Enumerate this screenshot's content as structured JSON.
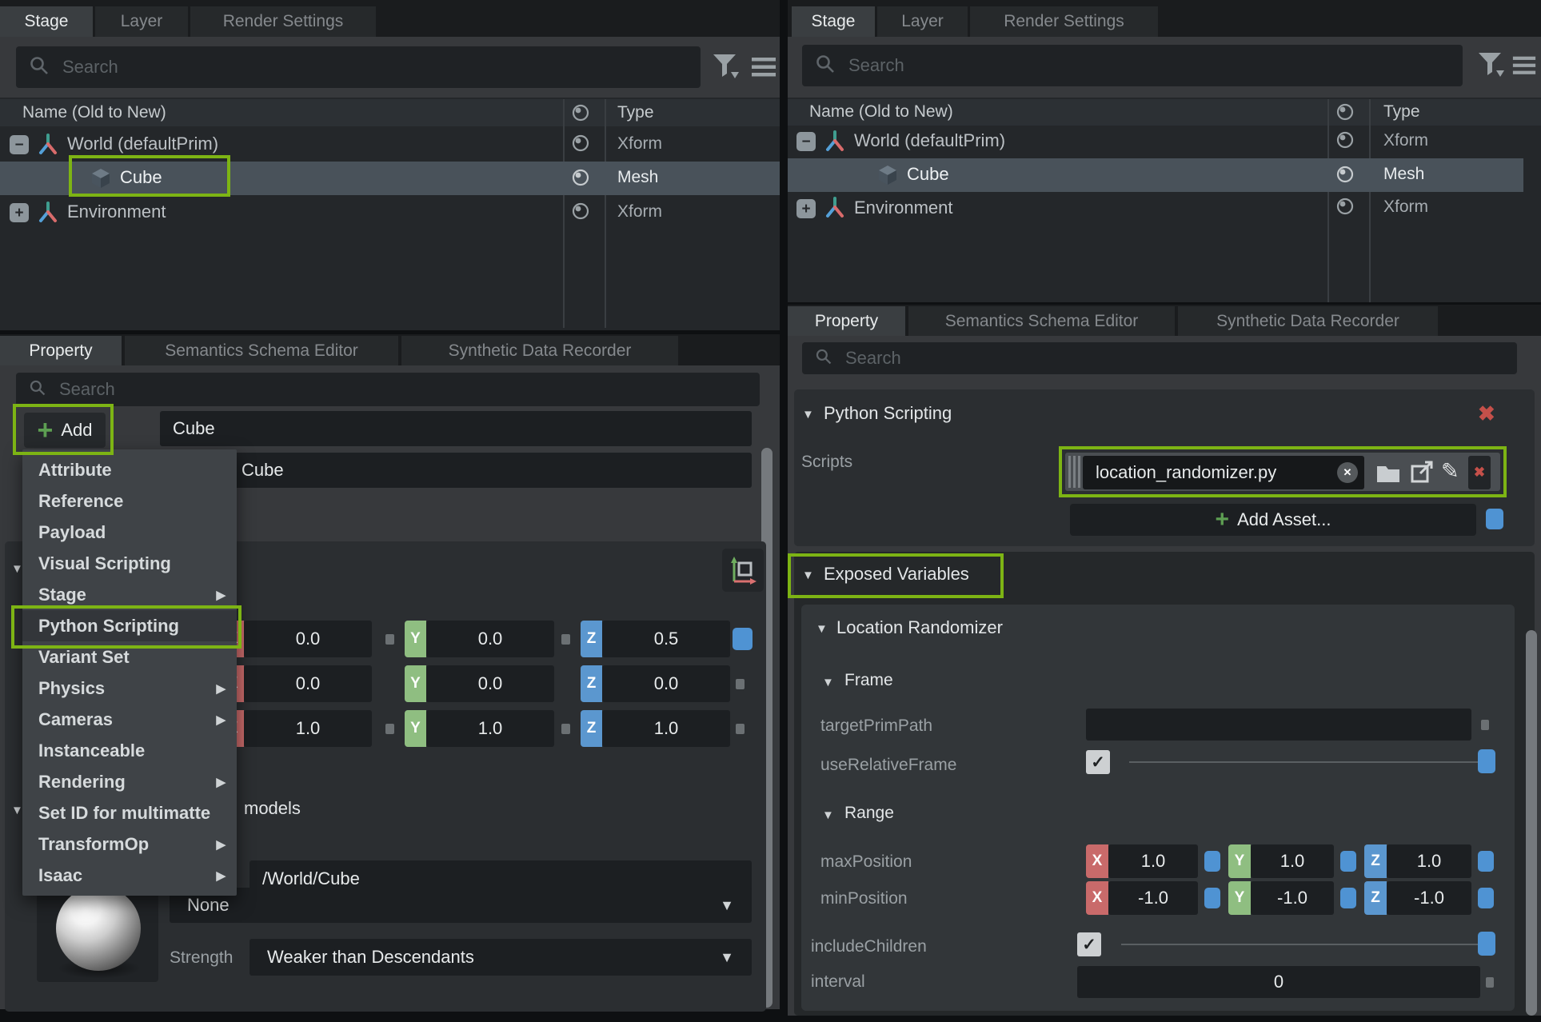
{
  "icons": {
    "submenu_arrow": "▶",
    "collapse_triangle": "▼",
    "dropdown_arrow": "▼",
    "checkmark": "✓",
    "close_x": "✖",
    "clear_x": "✕",
    "plus": "+",
    "pencil": "✎",
    "minus": "−",
    "expand_plus": "+"
  },
  "colors": {
    "highlight_green": "#7db414",
    "axis_x_red": "#c96a6a",
    "axis_y_green": "#8fbe81",
    "axis_z_blue": "#5b97cf",
    "accent_blue": "#4f93d3",
    "close_red": "#c5504a",
    "add_green": "#5d9e52"
  },
  "axis": {
    "x": "X",
    "y": "Y",
    "z": "Z"
  },
  "left": {
    "stage": {
      "tabs": [
        {
          "label": "Stage"
        },
        {
          "label": "Layer"
        },
        {
          "label": "Render Settings"
        }
      ],
      "search_placeholder": "Search",
      "columns": {
        "name": "Name (Old to New)",
        "type": "Type"
      },
      "rows": [
        {
          "name": "World (defaultPrim)",
          "type": "Xform"
        },
        {
          "name": "Cube",
          "type": "Mesh"
        },
        {
          "name": "Environment",
          "type": "Xform"
        }
      ]
    },
    "property": {
      "tabs": [
        {
          "label": "Property"
        },
        {
          "label": "Semantics Schema Editor"
        },
        {
          "label": "Synthetic Data Recorder"
        }
      ],
      "search_placeholder": "Search",
      "add_label": "Add",
      "prim_name": "Cube",
      "prim_name_2": "Cube",
      "menu_items": [
        {
          "label": "Attribute"
        },
        {
          "label": "Reference"
        },
        {
          "label": "Payload"
        },
        {
          "label": "Visual Scripting"
        },
        {
          "label": "Stage",
          "submenu": true
        },
        {
          "label": "Python Scripting",
          "highlighted": true
        },
        {
          "label": "Variant Set"
        },
        {
          "label": "Physics",
          "submenu": true
        },
        {
          "label": "Cameras",
          "submenu": true
        },
        {
          "label": "Instanceable"
        },
        {
          "label": "Rendering",
          "submenu": true
        },
        {
          "label": "Set ID for multimatte"
        },
        {
          "label": "TransformOp",
          "submenu": true
        },
        {
          "label": "Isaac",
          "submenu": true
        }
      ],
      "transform_rows": [
        {
          "x": "0.0",
          "y": "0.0",
          "z": "0.5"
        },
        {
          "x": "0.0",
          "y": "0.0",
          "z": "0.0"
        },
        {
          "x": "1.0",
          "y": "1.0",
          "z": "1.0"
        }
      ],
      "models_label": "models",
      "prim_path": "/World/Cube",
      "material_value": "None",
      "strength_label": "Strength",
      "strength_value": "Weaker than Descendants"
    }
  },
  "right": {
    "stage": {
      "tabs": [
        {
          "label": "Stage"
        },
        {
          "label": "Layer"
        },
        {
          "label": "Render Settings"
        }
      ],
      "search_placeholder": "Search",
      "columns": {
        "name": "Name (Old to New)",
        "type": "Type"
      },
      "rows": [
        {
          "name": "World (defaultPrim)",
          "type": "Xform"
        },
        {
          "name": "Cube",
          "type": "Mesh"
        },
        {
          "name": "Environment",
          "type": "Xform"
        }
      ]
    },
    "property": {
      "tabs": [
        {
          "label": "Property"
        },
        {
          "label": "Semantics Schema Editor"
        },
        {
          "label": "Synthetic Data Recorder"
        }
      ],
      "search_placeholder": "Search",
      "python": {
        "title": "Python Scripting",
        "scripts_label": "Scripts",
        "script_value": "location_randomizer.py",
        "add_asset_label": "Add Asset..."
      },
      "exposed": {
        "title": "Exposed Variables",
        "randomizer_title": "Location Randomizer",
        "frame_title": "Frame",
        "target_prim_path_label": "targetPrimPath",
        "target_prim_path_value": "",
        "use_relative_frame_label": "useRelativeFrame",
        "range_title": "Range",
        "max_position_label": "maxPosition",
        "max_position": {
          "x": "1.0",
          "y": "1.0",
          "z": "1.0"
        },
        "min_position_label": "minPosition",
        "min_position": {
          "x": "-1.0",
          "y": "-1.0",
          "z": "-1.0"
        },
        "include_children_label": "includeChildren",
        "interval_label": "interval",
        "interval_value": "0"
      }
    }
  }
}
